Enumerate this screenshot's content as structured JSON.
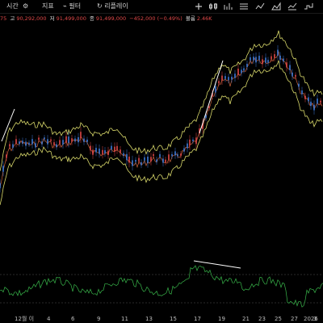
{
  "toolbar": {
    "tabs": [
      {
        "label": "시간",
        "name": "tab-time"
      },
      {
        "label": "지표",
        "name": "tab-indicators"
      },
      {
        "label": "필터",
        "name": "tab-filter"
      },
      {
        "label": "리플레이",
        "name": "tab-replay"
      }
    ],
    "icons": [
      "settings-icon",
      "grid-icon",
      "add-icon",
      "candle-icon",
      "line-icon",
      "area-icon",
      "hollow-candle-icon",
      "heikin-ashi-icon",
      "step-line-icon",
      "more-icon"
    ]
  },
  "price_info": {
    "open_prefix": "75",
    "high_label": "고",
    "high_value": "90,292,000",
    "low_label": "저",
    "low_value": "91,499,000",
    "close_label": "종",
    "close_value": "91,499,000",
    "change": "−452,000 (−0.49%)",
    "volume_label": "볼륨",
    "volume_value": "2.46K"
  },
  "x_axis_labels": [
    "12월 이",
    "4",
    "6",
    "9",
    "11",
    "13",
    "15",
    "17",
    "19",
    "21",
    "23",
    "25",
    "27",
    "2026",
    "3"
  ],
  "colors": {
    "background": "#000000",
    "up": "#e04848",
    "down": "#3d7bd9",
    "bollinger": "#d8d86a",
    "indicator": "#38b54a",
    "trendline": "#ffffff"
  }
}
